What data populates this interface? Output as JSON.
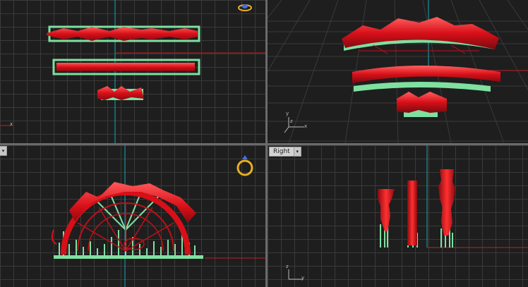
{
  "viewports": {
    "top_left": {
      "label": ""
    },
    "top_right": {
      "label": ""
    },
    "bottom_left": {
      "label": ""
    },
    "bottom_right": {
      "label": "Right"
    }
  },
  "icons": {
    "ring_top": "ring-icon",
    "ring_front": "ring-icon"
  },
  "axes": {
    "x": "x",
    "y": "y",
    "z": "z"
  },
  "colors": {
    "model": "#e0121c",
    "support": "#7fe0a0",
    "grid": "#3a3a3a",
    "axis_red": "#c0202a",
    "axis_cyan": "#1aa7b8",
    "ring_gold": "#e8b020"
  }
}
